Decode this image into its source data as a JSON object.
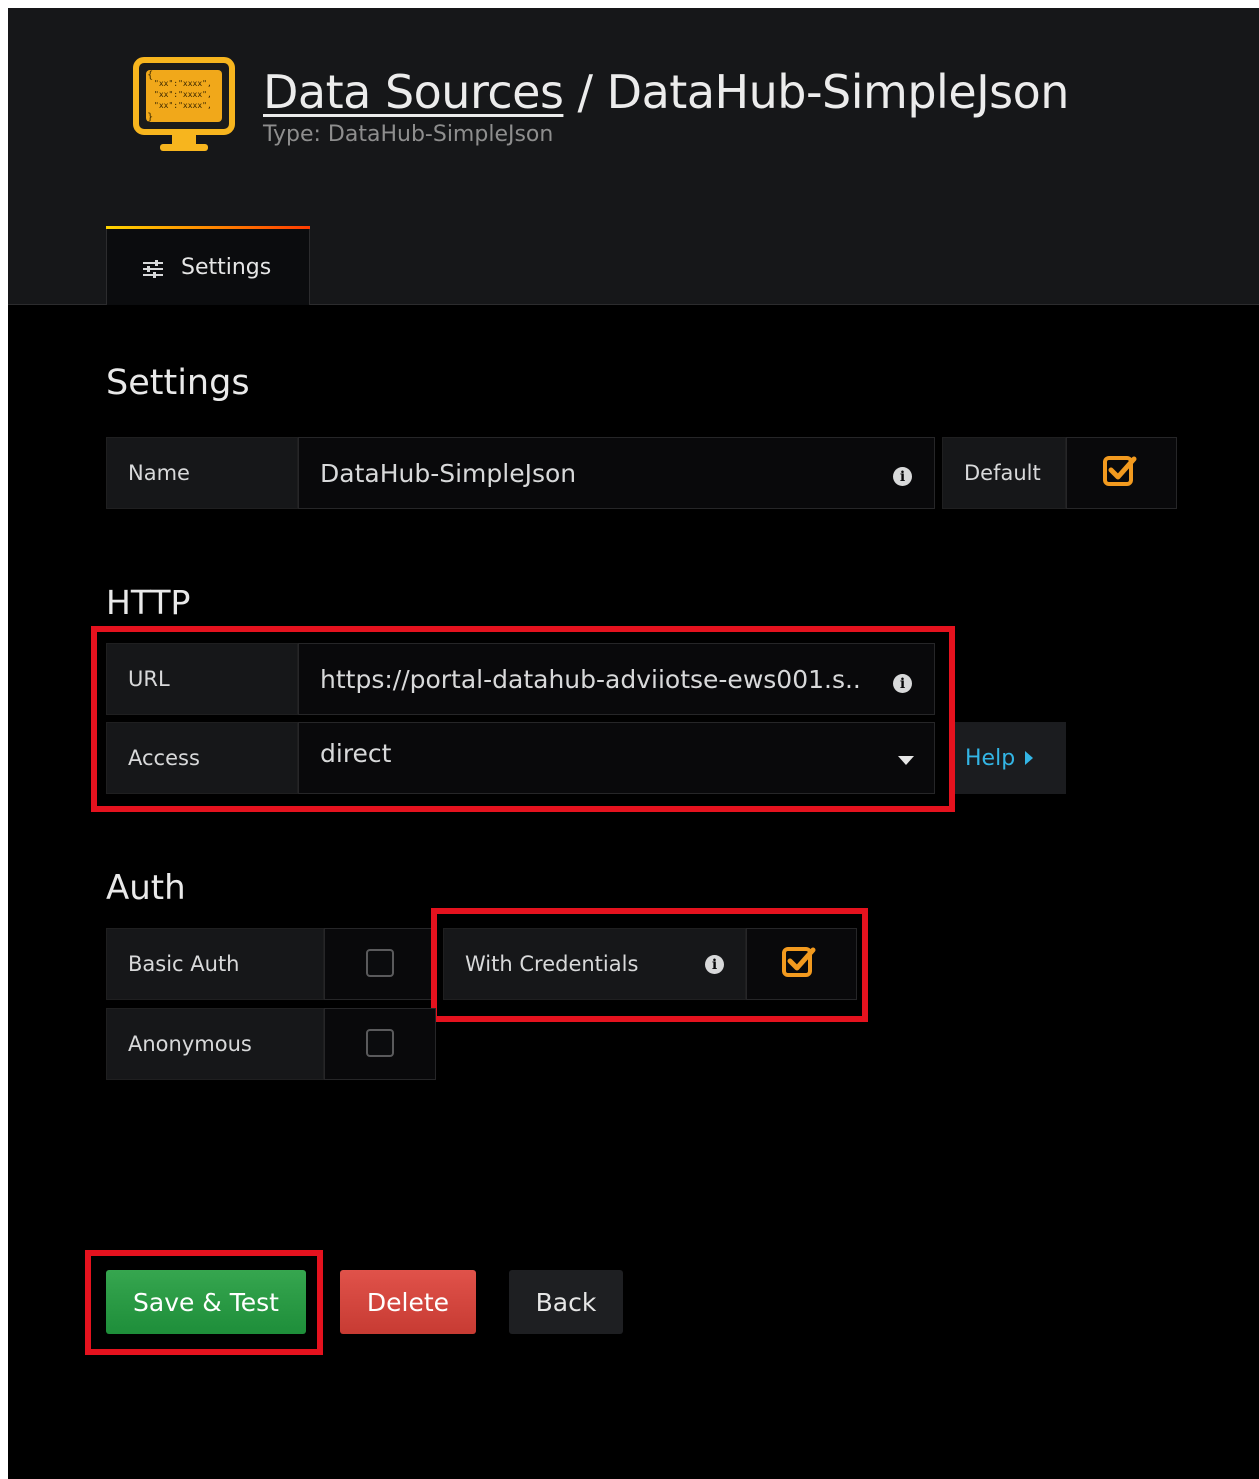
{
  "header": {
    "breadcrumb_link": "Data Sources",
    "separator": " / ",
    "title": "DataHub-SimpleJson",
    "subtitle": "Type: DataHub-SimpleJson",
    "logo_icon": "monitor-code-icon"
  },
  "tabs": [
    {
      "label": "Settings",
      "icon": "sliders-icon",
      "active": true
    }
  ],
  "settings": {
    "heading": "Settings",
    "name_label": "Name",
    "name_value": "DataHub-SimpleJson",
    "default_label": "Default",
    "default_checked": true
  },
  "http": {
    "heading": "HTTP",
    "url_label": "URL",
    "url_value": "https://portal-datahub-adviiotse-ews001.s..",
    "access_label": "Access",
    "access_value": "direct",
    "help_label": "Help"
  },
  "auth": {
    "heading": "Auth",
    "basic_auth_label": "Basic Auth",
    "basic_auth_checked": false,
    "with_credentials_label": "With Credentials",
    "with_credentials_checked": true,
    "anonymous_label": "Anonymous",
    "anonymous_checked": false
  },
  "buttons": {
    "save_test": "Save & Test",
    "delete": "Delete",
    "back": "Back"
  },
  "colors": {
    "accent_orange": "#f29a1f",
    "highlight_red": "#e5121e",
    "save_green": "#299c46",
    "delete_red": "#d44a3a",
    "help_blue": "#33b5e5"
  }
}
